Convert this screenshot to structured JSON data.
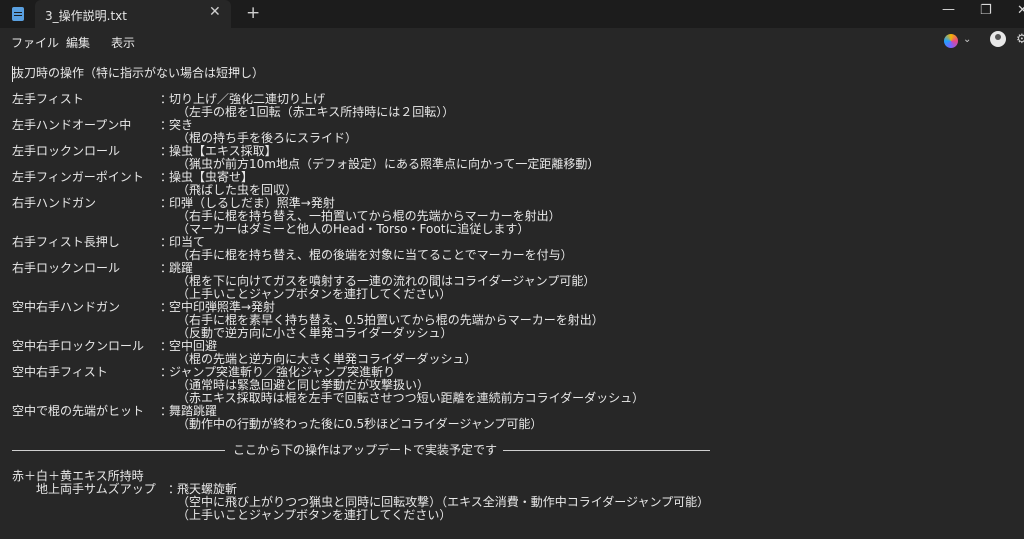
{
  "window": {
    "tab_title": "3_操作説明.txt",
    "close_tab": "✕",
    "new_tab": "+",
    "minimize": "—",
    "maximize": "❐",
    "close": "✕"
  },
  "menu": {
    "file": "ファイル",
    "edit": "編集",
    "view": "表示"
  },
  "toolbar": {
    "copilot_chevron": "⌄",
    "settings": "⚙"
  },
  "text": {
    "heading": "抜刀時の操作（特に指示がない場合は短押し）",
    "entries": [
      {
        "label": "左手フィスト",
        "sep": "：",
        "lines": [
          "切り上げ／強化二連切り上げ",
          "（左手の棍を1回転（赤エキス所持時には２回転））"
        ]
      },
      {
        "label": "左手ハンドオープン中",
        "sep": "：",
        "lines": [
          "突き",
          "（棍の持ち手を後ろにスライド）"
        ]
      },
      {
        "label": "左手ロックンロール",
        "sep": "：",
        "lines": [
          "操虫【エキス採取】",
          "（猟虫が前方10m地点（デフォ設定）にある照準点に向かって一定距離移動）"
        ]
      },
      {
        "label": "左手フィンガーポイント",
        "sep": "：",
        "lines": [
          "操虫【虫寄せ】",
          "（飛ばした虫を回収）"
        ]
      },
      {
        "label": "右手ハンドガン",
        "sep": "：",
        "lines": [
          "印弾（しるしだま）照準→発射",
          "（右手に棍を持ち替え、一拍置いてから棍の先端からマーカーを射出）",
          "（マーカーはダミーと他人のHead・Torso・Footに追従します）"
        ]
      },
      {
        "label": "右手フィスト長押し",
        "sep": "：",
        "lines": [
          "印当て",
          "（右手に棍を持ち替え、棍の後端を対象に当てることでマーカーを付与）"
        ]
      },
      {
        "label": "右手ロックンロール",
        "sep": "：",
        "lines": [
          "跳躍",
          "（棍を下に向けてガスを噴射する一連の流れの間はコライダージャンプ可能）",
          "（上手いことジャンプボタンを連打してください）"
        ]
      },
      {
        "label": "空中右手ハンドガン",
        "sep": "：",
        "lines": [
          "空中印弾照準→発射",
          "（右手に棍を素早く持ち替え、0.5拍置いてから棍の先端からマーカーを射出）",
          "（反動で逆方向に小さく単発コライダーダッシュ）"
        ]
      },
      {
        "label": "空中右手ロックンロール",
        "sep": "：",
        "lines": [
          "空中回避",
          "（棍の先端と逆方向に大きく単発コライダーダッシュ）"
        ]
      },
      {
        "label": "空中右手フィスト",
        "sep": "：",
        "lines": [
          "ジャンプ突進斬り／強化ジャンプ突進斬り",
          "（通常時は緊急回避と同じ挙動だが攻撃扱い）",
          "（赤エキス採取時は棍を左手で回転させつつ短い距離を連続前方コライダーダッシュ）"
        ]
      },
      {
        "label": "空中で棍の先端がヒット",
        "sep": "：",
        "lines": [
          "舞踏跳躍",
          "（動作中の行動が終わった後に0.5秒ほどコライダージャンプ可能）"
        ]
      }
    ],
    "divider_text": "ここから下の操作はアップデートで実装予定です",
    "future_group": "赤＋白＋黄エキス所持時",
    "future_entry": {
      "label": "地上両手サムズアップ",
      "sep": "：",
      "lines": [
        "飛天螺旋斬",
        "（空中に飛び上がりつつ猟虫と同時に回転攻撃）（エキス全消費・動作中コライダージャンプ可能）",
        "（上手いことジャンプボタンを連打してください）"
      ]
    }
  }
}
